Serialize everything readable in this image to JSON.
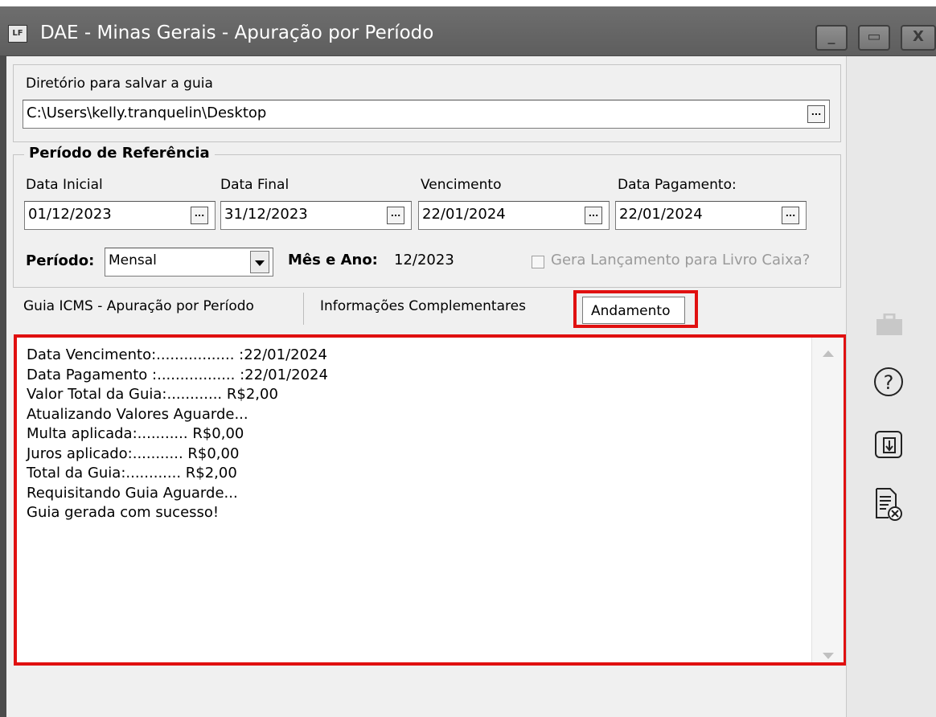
{
  "window": {
    "title": "DAE - Minas Gerais - Apuração por Período",
    "app_icon_text": "LF",
    "minimize_label": "_",
    "maximize_label": "▭",
    "close_label": "X"
  },
  "directory": {
    "label": "Diretório para salvar a guia",
    "value": "C:\\Users\\kelly.tranquelin\\Desktop",
    "browse_label": "..."
  },
  "periodo_group": {
    "title": "Período de Referência",
    "data_inicial": {
      "label": "Data Inicial",
      "value": "01/12/2023",
      "button": "..."
    },
    "data_final": {
      "label": "Data Final",
      "value": "31/12/2023",
      "button": "..."
    },
    "vencimento": {
      "label": "Vencimento",
      "value": "22/01/2024",
      "button": "..."
    },
    "data_pagamento": {
      "label": "Data Pagamento:",
      "value": "22/01/2024",
      "button": "..."
    },
    "periodo": {
      "label": "Período:",
      "selected": "Mensal"
    },
    "mes_ano": {
      "label": "Mês e Ano:",
      "value": "12/2023"
    },
    "livro_caixa": {
      "label": "Gera Lançamento para Livro Caixa?",
      "checked": false
    }
  },
  "tabs": [
    {
      "label": "Guia ICMS - Apuração por Período",
      "active": false
    },
    {
      "label": "Informações Complementares",
      "active": false
    },
    {
      "label": "Andamento",
      "active": true
    }
  ],
  "log": {
    "lines": [
      "Data Vencimento:................. :22/01/2024",
      "Data Pagamento :................. :22/01/2024",
      "Valor Total da Guia:............ R$2,00",
      "Atualizando Valores Aguarde...",
      "Multa aplicada:........... R$0,00",
      "Juros aplicado:........... R$0,00",
      "Total da Guia:............ R$2,00",
      "Requisitando Guia Aguarde...",
      "Guia gerada com sucesso!"
    ]
  },
  "side_toolbar": {
    "icons": [
      "briefcase-icon",
      "help-icon",
      "download-icon",
      "delete-document-icon"
    ],
    "help_glyph": "?"
  },
  "colors": {
    "highlight": "#e01010",
    "titlebar": "#666666"
  }
}
